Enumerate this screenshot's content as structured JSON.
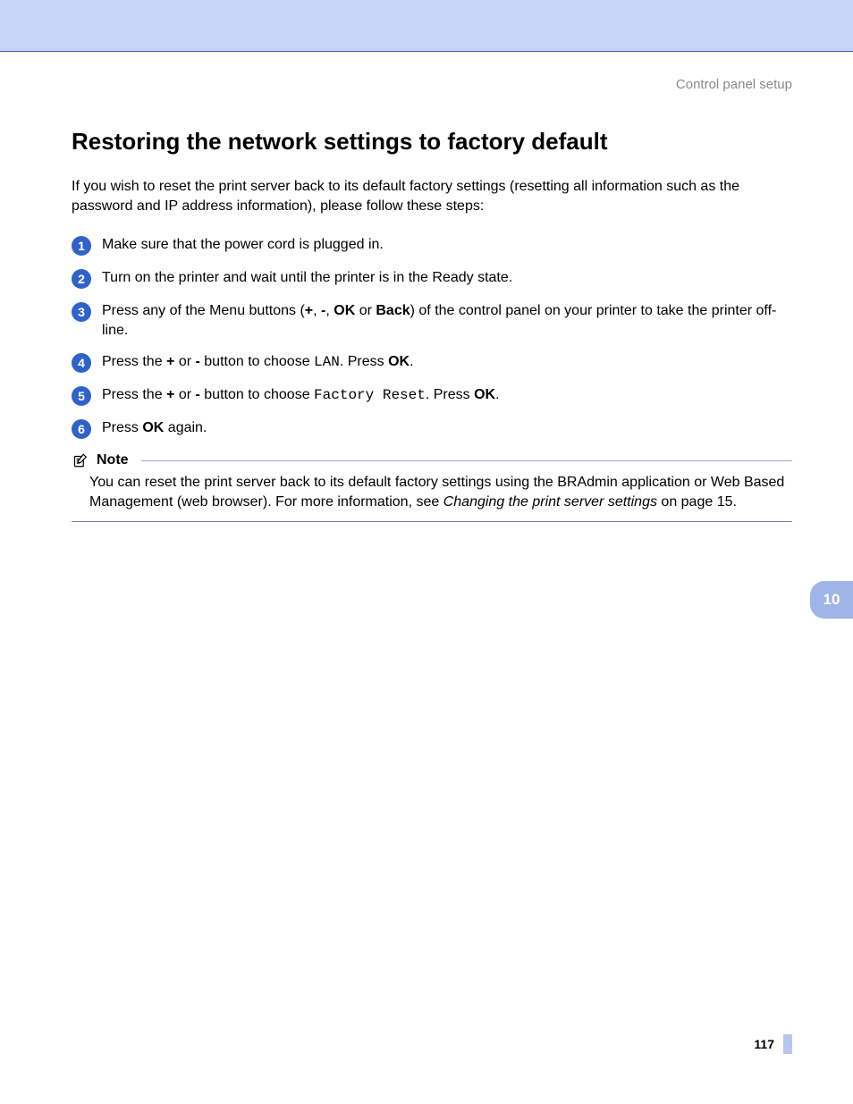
{
  "header": {
    "section_label": "Control panel setup"
  },
  "title": "Restoring the network settings to factory default",
  "intro": "If you wish to reset the print server back to its default factory settings (resetting all information such as the password and IP address information), please follow these steps:",
  "steps": [
    {
      "n": "1",
      "html": "Make sure that the power cord is plugged in."
    },
    {
      "n": "2",
      "html": "Turn on the printer and wait until the printer is in the Ready state."
    },
    {
      "n": "3",
      "html": "Press any of the Menu buttons (<b>+</b>, <b>-</b>, <b>OK</b> or <b>Back</b>) of the control panel on your printer to take the printer off-line."
    },
    {
      "n": "4",
      "html": "Press the <b>+</b> or <b>-</b> button to choose <span class=\"mono\">LAN</span>. Press <b>OK</b>."
    },
    {
      "n": "5",
      "html": "Press the <b>+</b> or <b>-</b> button to choose <span class=\"mono\">Factory Reset</span>. Press <b>OK</b>."
    },
    {
      "n": "6",
      "html": "Press <b>OK</b> again."
    }
  ],
  "note": {
    "label": "Note",
    "body_html": "You can reset the print server back to its default factory settings using the BRAdmin application or Web Based Management (web browser). For more information, see <span class=\"ital\">Changing the print server settings</span> on page 15."
  },
  "side_tab": "10",
  "page_number": "117"
}
